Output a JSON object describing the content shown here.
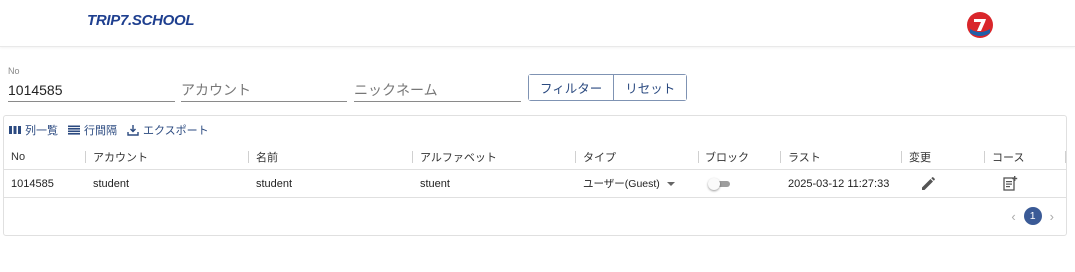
{
  "header": {
    "brand": "TRIP7.SCHOOL",
    "logo_icon": "trip7-logo-icon"
  },
  "filters": {
    "no_label": "No",
    "no_value": "1014585",
    "account_placeholder": "アカウント",
    "nickname_placeholder": "ニックネーム",
    "filter_button": "フィルター",
    "reset_button": "リセット"
  },
  "toolbar": {
    "columns_label": "列一覧",
    "density_label": "行間隔",
    "export_label": "エクスポート"
  },
  "table": {
    "columns": [
      "No",
      "アカウント",
      "名前",
      "アルファベット",
      "タイプ",
      "ブロック",
      "ラスト",
      "変更",
      "コース"
    ],
    "rows": [
      {
        "no": "1014585",
        "account": "student",
        "name": "student",
        "alphabet": "stuent",
        "type": "ユーザー(Guest)",
        "blocked": false,
        "last": "2025-03-12 11:27:33",
        "edit_icon": "pencil-icon",
        "course_icon": "note-add-icon"
      }
    ]
  },
  "pagination": {
    "current_page": "1"
  },
  "colors": {
    "brand": "#1e3f8f",
    "accent": "#3a5a96"
  }
}
